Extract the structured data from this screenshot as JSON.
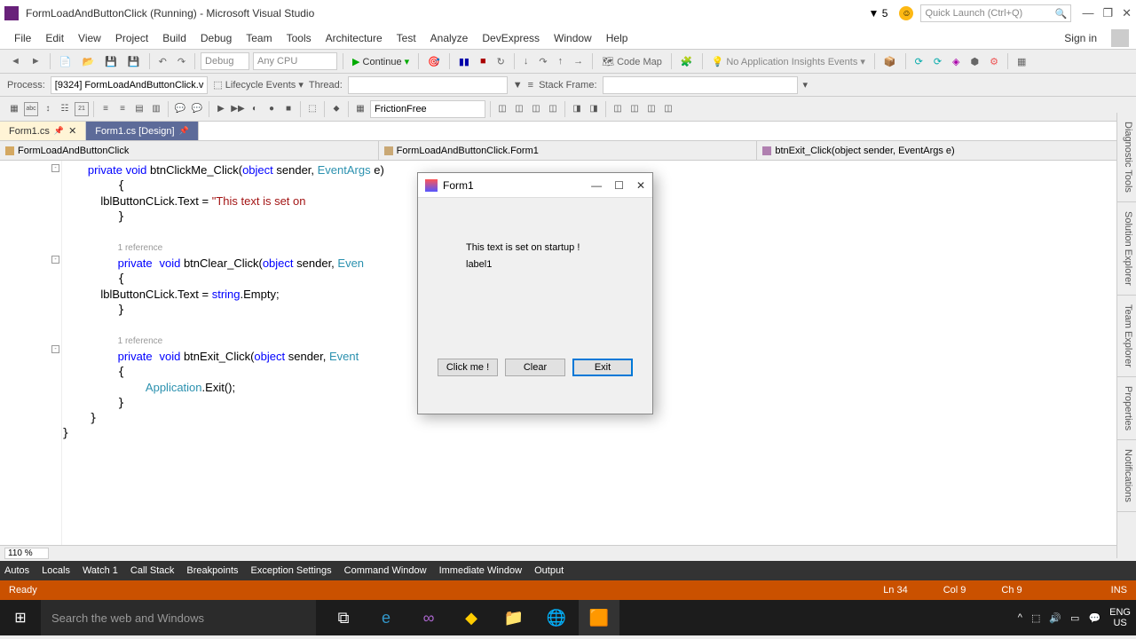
{
  "titlebar": {
    "title": "FormLoadAndButtonClick (Running) - Microsoft Visual Studio",
    "flag_count": "5",
    "quick_launch": "Quick Launch (Ctrl+Q)"
  },
  "menu": {
    "items": [
      "File",
      "Edit",
      "View",
      "Project",
      "Build",
      "Debug",
      "Team",
      "Tools",
      "Architecture",
      "Test",
      "Analyze",
      "DevExpress",
      "Window",
      "Help"
    ],
    "signin": "Sign in"
  },
  "toolbar1": {
    "config": "Debug",
    "platform": "Any CPU",
    "continue": "Continue",
    "codemap": "Code Map",
    "insights": "No Application Insights Events"
  },
  "toolbar2": {
    "process_lbl": "Process:",
    "process": "[9324] FormLoadAndButtonClick.v",
    "lifecycle": "Lifecycle Events",
    "thread_lbl": "Thread:",
    "stackframe_lbl": "Stack Frame:"
  },
  "toolbar3": {
    "friction": "FrictionFree"
  },
  "tabs": [
    {
      "label": "Form1.cs",
      "active": true,
      "pinned": true
    },
    {
      "label": "Form1.cs [Design]",
      "active": false,
      "pinned": true
    }
  ],
  "navbar": {
    "namespace": "FormLoadAndButtonClick",
    "class": "FormLoadAndButtonClick.Form1",
    "method": "btnExit_Click(object sender, EventArgs e)"
  },
  "code": {
    "ref1": "1 reference",
    "ref2": "1 reference",
    "line1a": "private",
    "line1b": "void",
    "line1c": " btnClickMe_Click(",
    "line1d": "object",
    "line1e": " sender, ",
    "line1f": "EventArgs",
    "line1g": " e)",
    "line3": "            lblButtonCLick.Text = ",
    "line3str": "\"This text is set on ",
    "line6a": "private",
    "line6b": "void",
    "line6c": " btnClear_Click(",
    "line6d": "object",
    "line6e": " sender, ",
    "line6f": "Even",
    "line8a": "            lblButtonCLick.Text = ",
    "line8b": "string",
    "line8c": ".Empty;",
    "line11a": "private",
    "line11b": "void",
    "line11c": " btnExit_Click(",
    "line11d": "object",
    "line11e": " sender, ",
    "line11f": "Event",
    "line13a": "Application",
    "line13b": ".Exit();"
  },
  "zoom": "110 %",
  "sidepanel": [
    "Diagnostic Tools",
    "Solution Explorer",
    "Team Explorer",
    "Properties",
    "Notifications"
  ],
  "bottomtabs": [
    "Autos",
    "Locals",
    "Watch 1",
    "Call Stack",
    "Breakpoints",
    "Exception Settings",
    "Command Window",
    "Immediate Window",
    "Output"
  ],
  "statusbar": {
    "ready": "Ready",
    "ln": "Ln 34",
    "col": "Col 9",
    "ch": "Ch 9",
    "ins": "INS"
  },
  "runform": {
    "title": "Form1",
    "label1": "This text is set on startup !",
    "label2": "label1",
    "btn1": "Click me !",
    "btn2": "Clear",
    "btn3": "Exit"
  },
  "taskbar": {
    "search": "Search the web and Windows",
    "lang": "ENG",
    "region": "US"
  }
}
